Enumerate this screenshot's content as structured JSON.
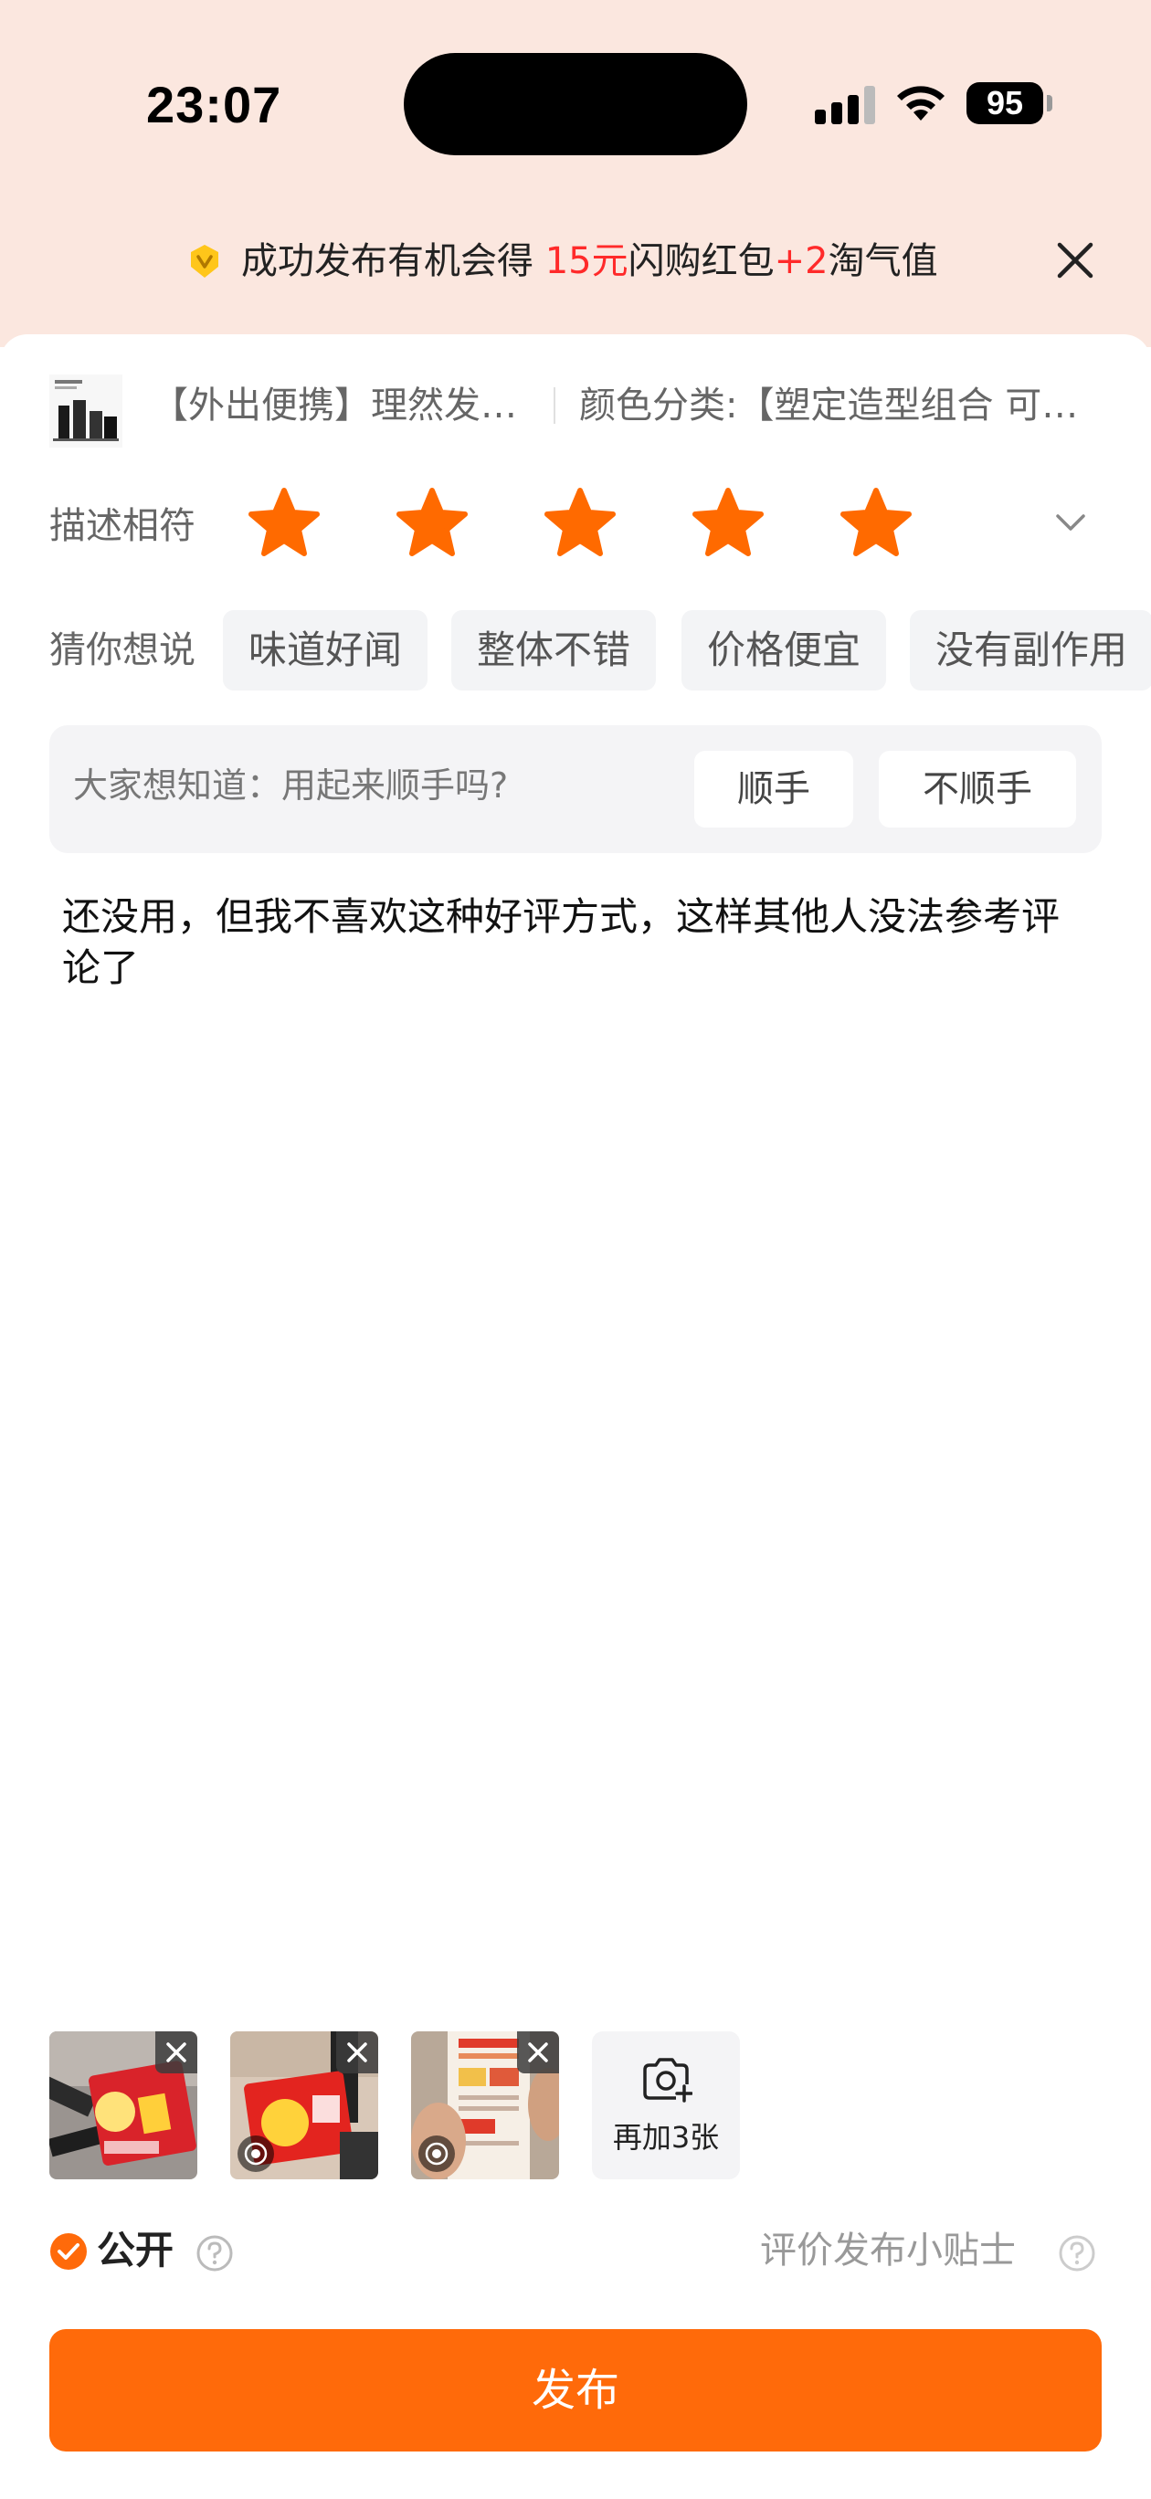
{
  "status_bar": {
    "time": "23:07",
    "battery": "95"
  },
  "banner": {
    "text_before": "成功发布有机会得 ",
    "amount": "15元",
    "text_middle": "闪购红包",
    "bonus": "+2",
    "text_after": "淘气值",
    "icon": "v-badge-icon",
    "close_icon": "close-icon"
  },
  "product": {
    "name": "【外出便携】理然发胶发蜡喷雾定型男士",
    "sku": "颜色分类:【塑定造型组合 可随身携带】"
  },
  "rating": {
    "label": "描述相符",
    "stars": 5,
    "max_stars": 5,
    "star_color": "#ff6a00"
  },
  "suggestions": {
    "label": "猜你想说",
    "tags": [
      "味道好闻",
      "整体不错",
      "价格便宜",
      "没有副作用"
    ]
  },
  "question": {
    "text": "大家想知道：用起来顺手吗?",
    "options": [
      "顺手",
      "不顺手"
    ]
  },
  "review": {
    "text": "还没用，但我不喜欢这种好评方式，这样其他人没法参考评论了"
  },
  "photos": {
    "add_label": "再加3张"
  },
  "visibility": {
    "public_label": "公开",
    "tips_label": "评价发布小贴士"
  },
  "publish": {
    "label": "发布",
    "color": "#ff6a0a"
  }
}
